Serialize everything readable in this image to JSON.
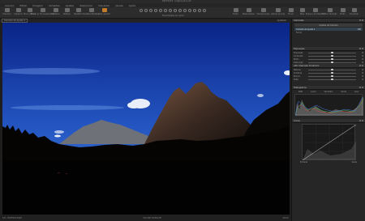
{
  "window": {
    "title": "DSCF0123 - Capture One 20"
  },
  "menu": [
    "Arquivo",
    "Editar",
    "Imagem",
    "Camadas",
    "Ajustar",
    "Selecionar",
    "Visualizar",
    "Janela",
    "Ajuda"
  ],
  "toolbar": {
    "left": [
      {
        "label": "Importar",
        "icon": "import-icon"
      },
      {
        "label": "Capturar",
        "icon": "camera-icon"
      },
      {
        "label": "Novo Album",
        "icon": "album-icon"
      },
      {
        "label": "Mover p/ Processamento",
        "icon": "move-icon"
      },
      {
        "label": "Desfazer",
        "icon": "undo-icon"
      },
      {
        "label": "Refazer",
        "icon": "redo-icon"
      },
      {
        "label": "Redefinir",
        "icon": "reset-icon"
      },
      {
        "label": "Desfazer/Refazer",
        "icon": "history-icon"
      },
      {
        "label": "Auto ajustar",
        "icon": "auto-adjust-icon"
      }
    ],
    "cursor_tools_label": "Ferramentas do cursor",
    "right": [
      {
        "label": "Exibir",
        "icon": "view-icon"
      },
      {
        "label": "Realce/Aviso",
        "icon": "exposure-warning-icon"
      },
      {
        "label": "Sobreposição",
        "icon": "overlay-icon"
      },
      {
        "label": "Aplicar provas",
        "icon": "proof-icon"
      },
      {
        "label": "Prova",
        "icon": "proof-mode-icon"
      },
      {
        "label": "Mais",
        "icon": "more-icon"
      },
      {
        "label": "Espaço de trabalho",
        "icon": "workspace-icon"
      },
      {
        "label": "Editar Variação",
        "icon": "edit-variant-icon"
      },
      {
        "label": "Exibir",
        "icon": "viewer-icon"
      },
      {
        "label": "Visualizar",
        "icon": "preview-icon"
      }
    ]
  },
  "subbar": {
    "layer": "Camada de Ajuste 1",
    "mode": "Ajustado"
  },
  "status": {
    "left": "1/6 - DSCF0123.RAF",
    "center": "ISO 200   1/250s   f/8",
    "right": "14mm"
  },
  "panel": {
    "layers_title": "Camadas",
    "layers_style_label": "Ajustes de Camada",
    "selected_layer": "Camada de Ajuste 1",
    "selected_opacity": "100",
    "layer_background": "Fundo",
    "exposure": {
      "title": "Exposição",
      "rows": [
        {
          "label": "Exposição",
          "value": "0",
          "pos": 0.5
        },
        {
          "label": "Contraste",
          "value": "0",
          "pos": 0.5
        },
        {
          "label": "Brilho",
          "value": "0",
          "pos": 0.5
        },
        {
          "label": "Saturação",
          "value": "0",
          "pos": 0.5
        }
      ]
    },
    "hdr": {
      "title": "Alto Intervalo Dinâmico",
      "rows": [
        {
          "label": "Realces",
          "value": "0",
          "pos": 0.5
        },
        {
          "label": "Sombras",
          "value": "0",
          "pos": 0.5
        },
        {
          "label": "Branco",
          "value": "0",
          "pos": 0.5
        },
        {
          "label": "Preto",
          "value": "0",
          "pos": 0.5
        }
      ]
    },
    "histogram_title": "Histograma",
    "histogram_tabs": [
      "RGB",
      "Luma",
      "Vermelho",
      "Verde",
      "Azul"
    ],
    "curve_title": "Curva",
    "curve_values": [
      "Entrada",
      "Saída"
    ]
  },
  "colors": {
    "sky_top": "#0a2487",
    "sky_bottom": "#3f78d8",
    "panel_bg": "#262626",
    "accent": "#c47a2a"
  }
}
